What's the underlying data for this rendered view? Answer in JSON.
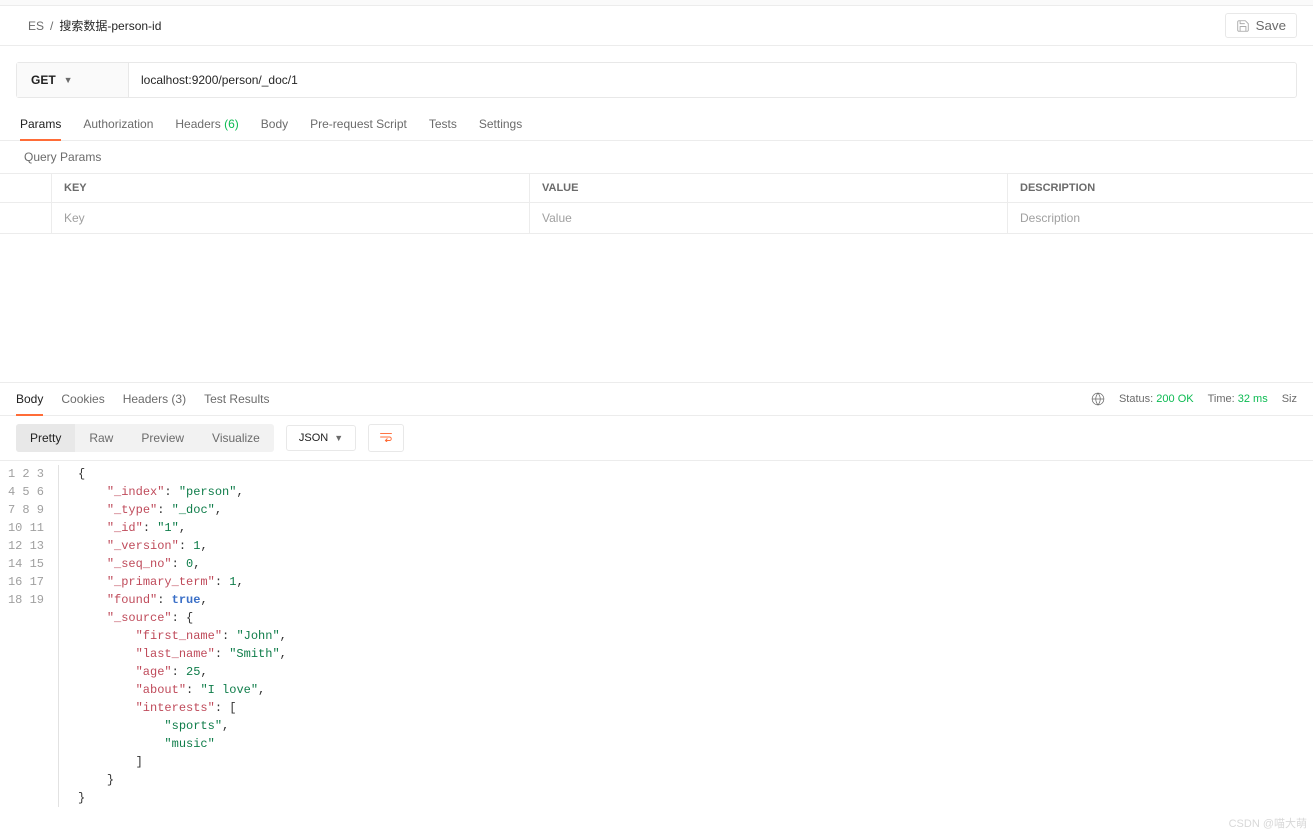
{
  "breadcrumb": {
    "root": "ES",
    "sep": "/",
    "current": "搜索数据-person-id"
  },
  "save": {
    "label": "Save"
  },
  "request": {
    "method": "GET",
    "url": "localhost:9200/person/_doc/1"
  },
  "reqTabs": {
    "params": "Params",
    "authorization": "Authorization",
    "headers_label": "Headers",
    "headers_count": "(6)",
    "body": "Body",
    "prerequest": "Pre-request Script",
    "tests": "Tests",
    "settings": "Settings"
  },
  "queryParams": {
    "title": "Query Params",
    "th_key": "KEY",
    "th_val": "VALUE",
    "th_desc": "DESCRIPTION",
    "ph_key": "Key",
    "ph_val": "Value",
    "ph_desc": "Description"
  },
  "resTabs": {
    "body": "Body",
    "cookies": "Cookies",
    "headers_label": "Headers",
    "headers_count": "(3)",
    "test_results": "Test Results"
  },
  "status": {
    "status_label": "Status:",
    "status_value": "200 OK",
    "time_label": "Time:",
    "time_value": "32 ms",
    "size_label": "Siz"
  },
  "viewModes": {
    "pretty": "Pretty",
    "raw": "Raw",
    "preview": "Preview",
    "visualize": "Visualize"
  },
  "format": "JSON",
  "responseJson": {
    "_index": "person",
    "_type": "_doc",
    "_id": "1",
    "_version": 1,
    "_seq_no": 0,
    "_primary_term": 1,
    "found": true,
    "_source": {
      "first_name": "John",
      "last_name": "Smith",
      "age": 25,
      "about": "I love",
      "interests": [
        "sports",
        "music"
      ]
    }
  },
  "watermark": "CSDN @喵大萌"
}
